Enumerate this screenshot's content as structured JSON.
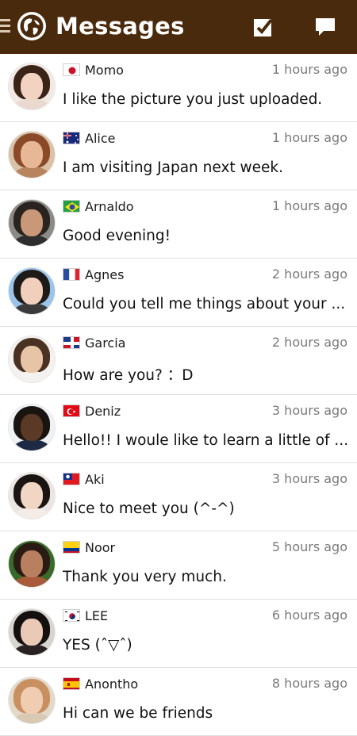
{
  "header": {
    "title": "Messages"
  },
  "conversations": [
    {
      "name": "Momo",
      "time": "1 hours ago",
      "message": "I like the picture you just uploaded.",
      "flag": "japan",
      "avatar": {
        "bg": "#f3e9e3",
        "hair": "#3a2418",
        "skin": "#f2d3c1",
        "shirt": "#e9d9cf"
      }
    },
    {
      "name": "Alice",
      "time": "1 hours ago",
      "message": "I am visiting Japan next week.",
      "flag": "australia",
      "avatar": {
        "bg": "#d9c2a8",
        "hair": "#8a4a2a",
        "skin": "#e8b896",
        "shirt": "#b8845e"
      }
    },
    {
      "name": "Arnaldo",
      "time": "1 hours ago",
      "message": "Good evening!",
      "flag": "brazil",
      "avatar": {
        "bg": "#8a8a86",
        "hair": "#2a2420",
        "skin": "#c89878",
        "shirt": "#2e2e30"
      }
    },
    {
      "name": "Agnes",
      "time": "2 hours ago",
      "message": "Could you tell me things about your ...",
      "flag": "france",
      "avatar": {
        "bg": "#9cc4e8",
        "hair": "#1e1a18",
        "skin": "#f0d0bc",
        "shirt": "#3a3a3a"
      }
    },
    {
      "name": "Garcia",
      "time": "2 hours ago",
      "message": "How are you? ：D",
      "flag": "dominican",
      "avatar": {
        "bg": "#f4f1ee",
        "hair": "#4a3222",
        "skin": "#e8c4a6",
        "shirt": "#f4f1ee"
      }
    },
    {
      "name": "Deniz",
      "time": "3 hours ago",
      "message": "Hello!! I woule like to learn a little of ...",
      "flag": "turkey",
      "avatar": {
        "bg": "#eef2f4",
        "hair": "#1a1410",
        "skin": "#5a3a26",
        "shirt": "#1e2a44"
      }
    },
    {
      "name": "Aki",
      "time": "3 hours ago",
      "message": "Nice to meet you (^-^)",
      "flag": "taiwan",
      "avatar": {
        "bg": "#ece6e2",
        "hair": "#1a1412",
        "skin": "#f2d6c4",
        "shirt": "#f4ece6"
      }
    },
    {
      "name": "Noor",
      "time": "5 hours ago",
      "message": "Thank you very much.",
      "flag": "colombia",
      "avatar": {
        "bg": "#3a6a2a",
        "hair": "#2a1c14",
        "skin": "#b88060",
        "shirt": "#a85a3a"
      }
    },
    {
      "name": "LEE",
      "time": "6 hours ago",
      "message": "YES (ˆ▽ˆ)",
      "flag": "korea",
      "avatar": {
        "bg": "#d8d4d0",
        "hair": "#141010",
        "skin": "#eacab6",
        "shirt": "#2a2222"
      }
    },
    {
      "name": "Anontho",
      "time": "8 hours ago",
      "message": "Hi can we be friends",
      "flag": "spain",
      "avatar": {
        "bg": "#e4d8c8",
        "hair": "#c89060",
        "skin": "#f0ccb0",
        "shirt": "#d8c8b4"
      }
    }
  ]
}
